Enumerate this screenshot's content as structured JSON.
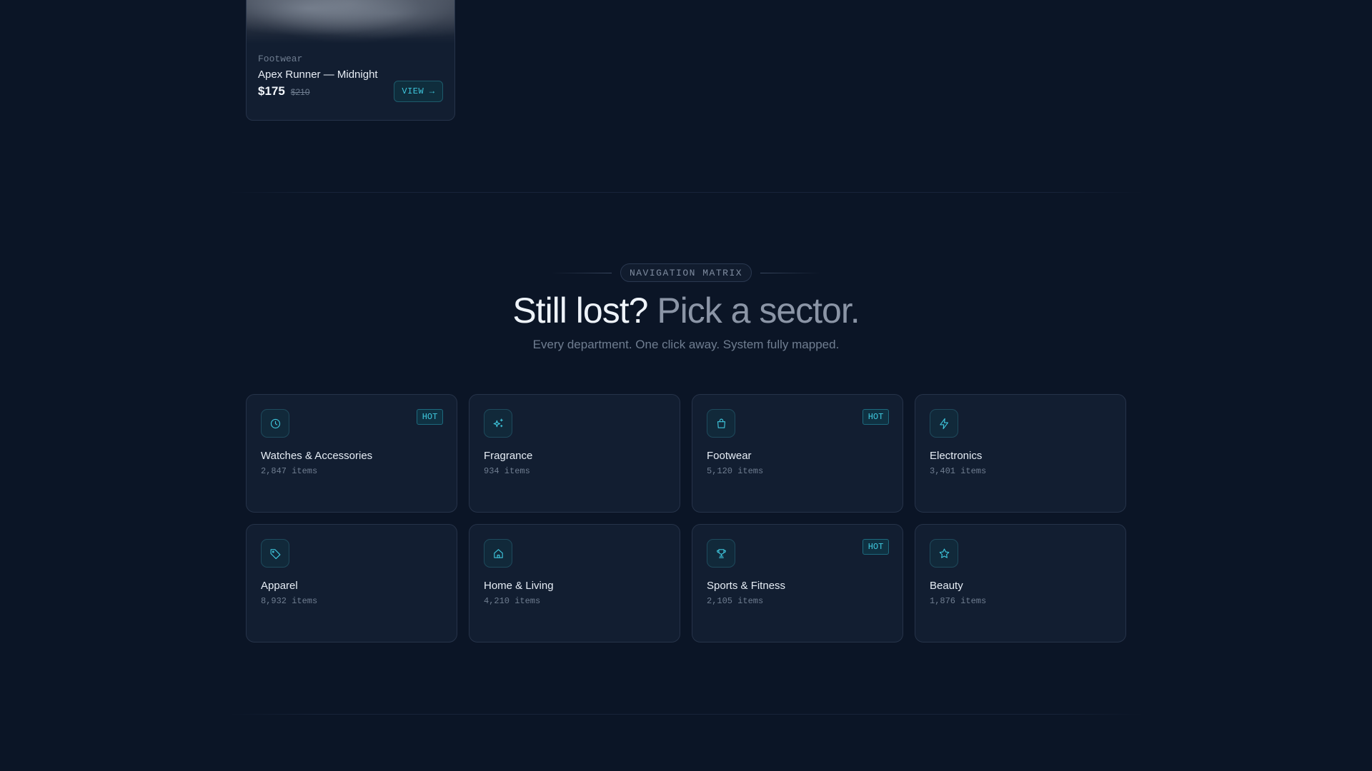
{
  "product": {
    "category": "Footwear",
    "name": "Apex Runner — Midnight",
    "price": "$175",
    "old_price": "$210",
    "view_label": "VIEW →"
  },
  "section": {
    "eyebrow": "NAVIGATION MATRIX",
    "headline_strong": "Still lost?",
    "headline_muted": "Pick a sector.",
    "subtitle": "Every department. One click away. System fully mapped."
  },
  "categories": [
    {
      "name": "Watches & Accessories",
      "count": "2,847 items",
      "badge": "HOT",
      "icon": "clock-icon"
    },
    {
      "name": "Fragrance",
      "count": "934 items",
      "badge": "",
      "icon": "sparkles-icon"
    },
    {
      "name": "Footwear",
      "count": "5,120 items",
      "badge": "HOT",
      "icon": "shopping-bag-icon"
    },
    {
      "name": "Electronics",
      "count": "3,401 items",
      "badge": "",
      "icon": "lightning-icon"
    },
    {
      "name": "Apparel",
      "count": "8,932 items",
      "badge": "",
      "icon": "tag-icon"
    },
    {
      "name": "Home & Living",
      "count": "4,210 items",
      "badge": "",
      "icon": "home-icon"
    },
    {
      "name": "Sports & Fitness",
      "count": "2,105 items",
      "badge": "HOT",
      "icon": "trophy-icon"
    },
    {
      "name": "Beauty",
      "count": "1,876 items",
      "badge": "",
      "icon": "star-icon"
    }
  ],
  "colors": {
    "background": "#0b1526",
    "card": "#121e31",
    "accent": "#3fc7dd"
  }
}
